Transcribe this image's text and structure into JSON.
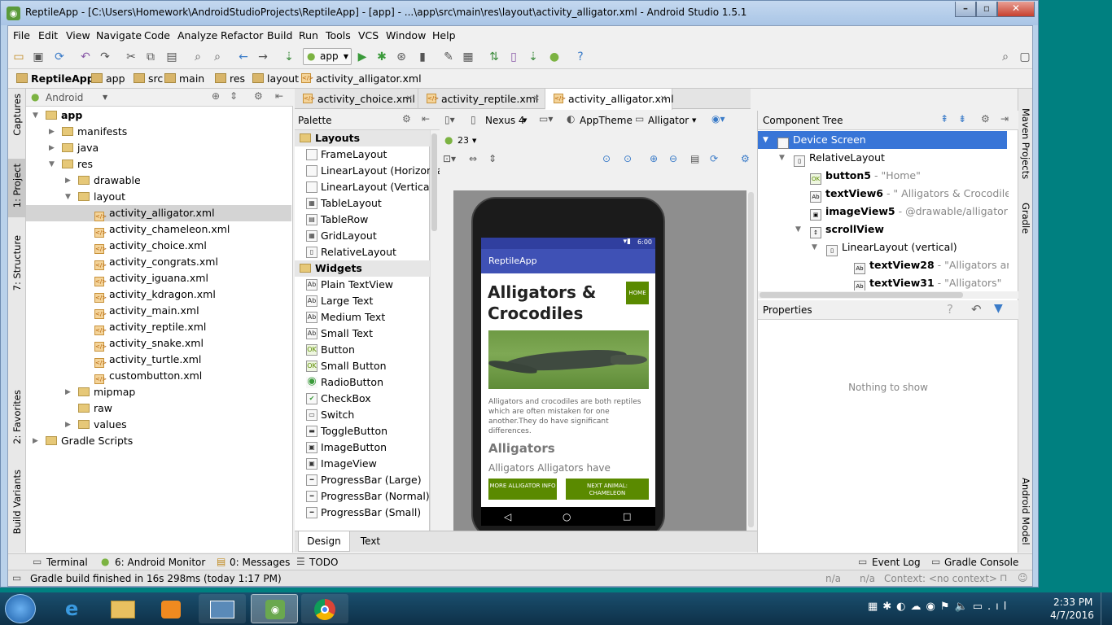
{
  "window": {
    "title": "ReptileApp - [C:\\Users\\Homework\\AndroidStudioProjects\\ReptileApp] - [app] - ...\\app\\src\\main\\res\\layout\\activity_alligator.xml - Android Studio 1.5.1"
  },
  "menu": [
    "File",
    "Edit",
    "View",
    "Navigate",
    "Code",
    "Analyze",
    "Refactor",
    "Build",
    "Run",
    "Tools",
    "VCS",
    "Window",
    "Help"
  ],
  "toolbar": {
    "run_config": "app"
  },
  "breadcrumb": [
    "ReptileApp",
    "app",
    "src",
    "main",
    "res",
    "layout",
    "activity_alligator.xml"
  ],
  "left_strip": [
    "Captures",
    "1: Project",
    "7: Structure",
    "2: Favorites",
    "Build Variants"
  ],
  "right_strip": [
    "Maven Projects",
    "Gradle",
    "Android Model"
  ],
  "project": {
    "view_mode": "Android",
    "tree": [
      {
        "label": "app",
        "level": 0,
        "bold": true,
        "arrow": "▼"
      },
      {
        "label": "manifests",
        "level": 1,
        "arrow": "▶"
      },
      {
        "label": "java",
        "level": 1,
        "arrow": "▶"
      },
      {
        "label": "res",
        "level": 1,
        "arrow": "▼"
      },
      {
        "label": "drawable",
        "level": 2,
        "arrow": "▶"
      },
      {
        "label": "layout",
        "level": 2,
        "arrow": "▼"
      },
      {
        "label": "activity_alligator.xml",
        "level": 3,
        "file": true,
        "selected": true
      },
      {
        "label": "activity_chameleon.xml",
        "level": 3,
        "file": true
      },
      {
        "label": "activity_choice.xml",
        "level": 3,
        "file": true
      },
      {
        "label": "activity_congrats.xml",
        "level": 3,
        "file": true
      },
      {
        "label": "activity_iguana.xml",
        "level": 3,
        "file": true
      },
      {
        "label": "activity_kdragon.xml",
        "level": 3,
        "file": true
      },
      {
        "label": "activity_main.xml",
        "level": 3,
        "file": true
      },
      {
        "label": "activity_reptile.xml",
        "level": 3,
        "file": true
      },
      {
        "label": "activity_snake.xml",
        "level": 3,
        "file": true
      },
      {
        "label": "activity_turtle.xml",
        "level": 3,
        "file": true
      },
      {
        "label": "custombutton.xml",
        "level": 3,
        "file": true
      },
      {
        "label": "mipmap",
        "level": 2,
        "arrow": "▶"
      },
      {
        "label": "raw",
        "level": 2
      },
      {
        "label": "values",
        "level": 2,
        "arrow": "▶"
      },
      {
        "label": "Gradle Scripts",
        "level": 0,
        "arrow": "▶"
      }
    ]
  },
  "editor_tabs": [
    "activity_choice.xml",
    "activity_reptile.xml",
    "activity_alligator.xml"
  ],
  "palette": {
    "title": "Palette",
    "items": [
      {
        "label": "Layouts",
        "cat": true
      },
      {
        "label": "FrameLayout",
        "ic": ""
      },
      {
        "label": "LinearLayout (Horizontal)",
        "ic": ""
      },
      {
        "label": "LinearLayout (Vertical)",
        "ic": ""
      },
      {
        "label": "TableLayout",
        "ic": "▦"
      },
      {
        "label": "TableRow",
        "ic": "▤"
      },
      {
        "label": "GridLayout",
        "ic": "▦"
      },
      {
        "label": "RelativeLayout",
        "ic": "▯"
      },
      {
        "label": "Widgets",
        "cat": true
      },
      {
        "label": "Plain TextView",
        "ic": "Ab"
      },
      {
        "label": "Large Text",
        "ic": "Ab"
      },
      {
        "label": "Medium Text",
        "ic": "Ab"
      },
      {
        "label": "Small Text",
        "ic": "Ab"
      },
      {
        "label": "Button",
        "ic": "OK"
      },
      {
        "label": "Small Button",
        "ic": "OK"
      },
      {
        "label": "RadioButton",
        "ic": "◉"
      },
      {
        "label": "CheckBox",
        "ic": "✔"
      },
      {
        "label": "Switch",
        "ic": "▭"
      },
      {
        "label": "ToggleButton",
        "ic": "▬"
      },
      {
        "label": "ImageButton",
        "ic": "▣"
      },
      {
        "label": "ImageView",
        "ic": "▣"
      },
      {
        "label": "ProgressBar (Large)",
        "ic": "━"
      },
      {
        "label": "ProgressBar (Normal)",
        "ic": "━"
      },
      {
        "label": "ProgressBar (Small)",
        "ic": "━"
      }
    ]
  },
  "designer": {
    "device": "Nexus 4",
    "theme": "AppTheme",
    "activity": "Alligator",
    "api": "23"
  },
  "phone": {
    "time": "6:00",
    "app_bar": "ReptileApp",
    "heading": "Alligators & Crocodiles",
    "home_btn": "HOME",
    "body": "Alligators and crocodiles are both reptiles which are often mistaken for one another.They do have significant differences.",
    "subheading": "Alligators",
    "cut_text": "Alligators  Alligators have",
    "btn_more": "MORE ALLIGATOR INFO",
    "btn_next": "NEXT ANIMAL: CHAMELEON"
  },
  "design_tabs": [
    "Design",
    "Text"
  ],
  "component_tree": {
    "title": "Component Tree",
    "rows": [
      {
        "name": "Device Screen",
        "detail": "",
        "level": 0,
        "selected": true,
        "arrow": "▼",
        "ic": "▯"
      },
      {
        "name": "RelativeLayout",
        "detail": "",
        "level": 1,
        "arrow": "▼",
        "ic": "▯"
      },
      {
        "name": "button5",
        "detail": " - \"Home\"",
        "level": 2,
        "bold": true,
        "ic": "OK"
      },
      {
        "name": "textView6",
        "detail": " - \" Alligators & Crocodiles\"",
        "level": 2,
        "bold": true,
        "ic": "Ab"
      },
      {
        "name": "imageView5",
        "detail": " - @drawable/alligator",
        "level": 2,
        "bold": true,
        "ic": "▣"
      },
      {
        "name": "scrollView",
        "detail": "",
        "level": 2,
        "bold": true,
        "arrow": "▼",
        "ic": "↕"
      },
      {
        "name": "LinearLayout (vertical)",
        "detail": "",
        "level": 3,
        "arrow": "▼",
        "ic": "▯"
      },
      {
        "name": "textView28",
        "detail": " - \"Alligators and croc",
        "level": 4,
        "bold": true,
        "ic": "Ab"
      },
      {
        "name": "textView31",
        "detail": " - \"Alligators\"",
        "level": 4,
        "bold": true,
        "ic": "Ab"
      }
    ]
  },
  "properties": {
    "title": "Properties",
    "empty": "Nothing to show"
  },
  "bottom_tabs": [
    "Terminal",
    "6: Android Monitor",
    "0: Messages",
    "TODO"
  ],
  "bottom_right_tabs": [
    "Event Log",
    "Gradle Console"
  ],
  "status": {
    "message": "Gradle build finished in 16s 298ms (today 1:17 PM)",
    "na1": "n/a",
    "na2": "n/a",
    "context": "Context: <no context>"
  },
  "taskbar": {
    "time": "2:33 PM",
    "date": "4/7/2016"
  }
}
